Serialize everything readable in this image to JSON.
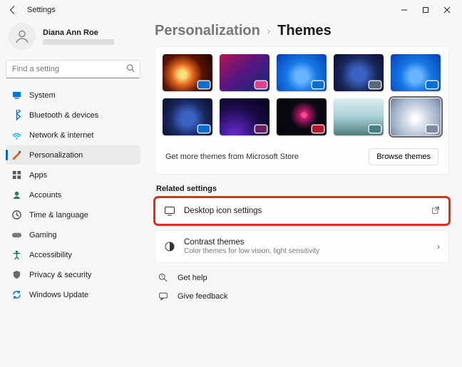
{
  "window": {
    "title": "Settings"
  },
  "user": {
    "name": "Diana Ann Roe"
  },
  "search": {
    "placeholder": "Find a setting"
  },
  "nav": {
    "items": [
      {
        "label": "System",
        "icon": "system",
        "color": "#0078d4"
      },
      {
        "label": "Bluetooth & devices",
        "icon": "bluetooth",
        "color": "#0078d4"
      },
      {
        "label": "Network & internet",
        "icon": "network",
        "color": "#00b0f0"
      },
      {
        "label": "Personalization",
        "icon": "personalization",
        "color": "#c7651b",
        "selected": true
      },
      {
        "label": "Apps",
        "icon": "apps",
        "color": "#555"
      },
      {
        "label": "Accounts",
        "icon": "accounts",
        "color": "#2a7a60"
      },
      {
        "label": "Time & language",
        "icon": "time",
        "color": "#555"
      },
      {
        "label": "Gaming",
        "icon": "gaming",
        "color": "#7a7a7a"
      },
      {
        "label": "Accessibility",
        "icon": "accessibility",
        "color": "#107c67"
      },
      {
        "label": "Privacy & security",
        "icon": "privacy",
        "color": "#6a6a6a"
      },
      {
        "label": "Windows Update",
        "icon": "update",
        "color": "#0078d4"
      }
    ]
  },
  "breadcrumb": {
    "parent": "Personalization",
    "current": "Themes"
  },
  "themes": {
    "items": [
      {
        "accent": "#0a6ed1"
      },
      {
        "accent": "#e0418f"
      },
      {
        "accent": "#0a6ed1"
      },
      {
        "accent": "#5b6977"
      },
      {
        "accent": "#0a6ed1"
      },
      {
        "accent": "#0a6ed1"
      },
      {
        "accent": "#6b1f62"
      },
      {
        "accent": "#b11a2f"
      },
      {
        "accent": "#467f86"
      },
      {
        "accent": "#7e8aa0",
        "selected": true
      }
    ],
    "store_text": "Get more themes from Microsoft Store",
    "browse_label": "Browse themes"
  },
  "related": {
    "heading": "Related settings",
    "desktop_icons": {
      "title": "Desktop icon settings"
    },
    "contrast": {
      "title": "Contrast themes",
      "subtitle": "Color themes for low vision, light sensitivity"
    }
  },
  "help": {
    "get_help": "Get help",
    "feedback": "Give feedback"
  }
}
